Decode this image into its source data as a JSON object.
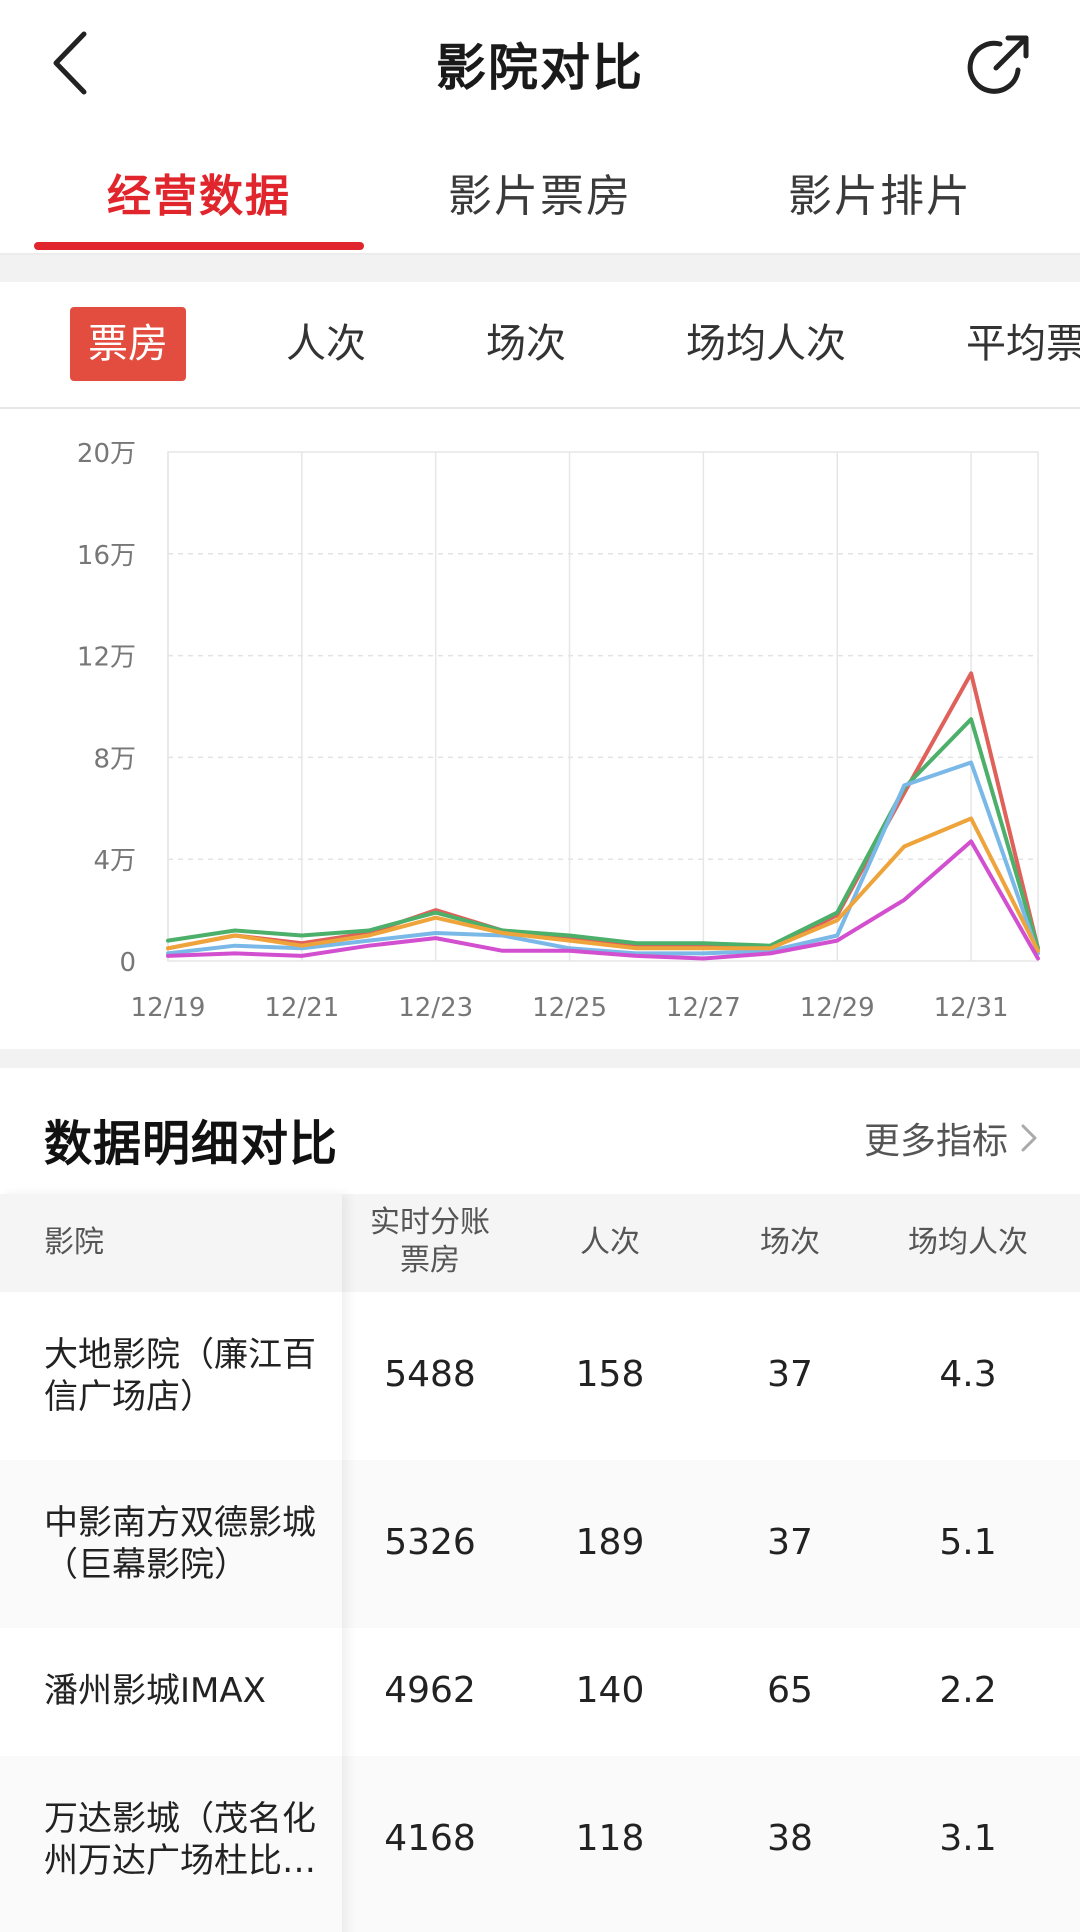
{
  "header": {
    "title": "影院对比",
    "back_icon": "chevron-left-icon",
    "share_icon": "share-icon"
  },
  "main_tabs": [
    {
      "label": "经营数据",
      "active": true
    },
    {
      "label": "影片票房",
      "active": false
    },
    {
      "label": "影片排片",
      "active": false
    }
  ],
  "metric_tabs": [
    {
      "label": "票房",
      "active": true
    },
    {
      "label": "人次",
      "active": false
    },
    {
      "label": "场次",
      "active": false
    },
    {
      "label": "场均人次",
      "active": false
    },
    {
      "label": "平均票",
      "active": false
    }
  ],
  "colors": {
    "accent": "#e0252d",
    "metric_active_bg": "#e34d3f",
    "series": [
      "#e0605a",
      "#4caf6a",
      "#7ab8e8",
      "#eea43a",
      "#d24fcf"
    ]
  },
  "chart_data": {
    "type": "line",
    "x": [
      "12/19",
      "12/20",
      "12/21",
      "12/22",
      "12/23",
      "12/24",
      "12/25",
      "12/26",
      "12/27",
      "12/28",
      "12/29",
      "12/30",
      "12/31",
      "1/1"
    ],
    "x_tick_labels": [
      "12/19",
      "12/21",
      "12/23",
      "12/25",
      "12/27",
      "12/29",
      "12/31"
    ],
    "y_tick_labels": [
      "0",
      "4万",
      "8万",
      "12万",
      "16万",
      "20万"
    ],
    "ylim": [
      0,
      200000
    ],
    "grid": true,
    "series": [
      {
        "color": "#e0605a",
        "values": [
          5000,
          10000,
          7000,
          11000,
          20000,
          12000,
          9000,
          6000,
          6000,
          5000,
          18000,
          66000,
          113000,
          5000
        ]
      },
      {
        "color": "#4caf6a",
        "values": [
          8000,
          12000,
          10000,
          12000,
          19000,
          12000,
          10000,
          7000,
          7000,
          6000,
          19000,
          68000,
          95000,
          5000
        ]
      },
      {
        "color": "#7ab8e8",
        "values": [
          3000,
          6000,
          5000,
          8000,
          11000,
          10000,
          5000,
          3000,
          3000,
          4000,
          10000,
          69000,
          78000,
          3000
        ]
      },
      {
        "color": "#eea43a",
        "values": [
          5000,
          10000,
          6000,
          10000,
          17000,
          11000,
          8000,
          5000,
          5000,
          5000,
          16000,
          45000,
          56000,
          4000
        ]
      },
      {
        "color": "#d24fcf",
        "values": [
          2000,
          3000,
          2000,
          6000,
          9000,
          4000,
          4000,
          2000,
          1000,
          3000,
          8000,
          24000,
          47000,
          1000
        ]
      }
    ]
  },
  "detail": {
    "title": "数据明细对比",
    "more_label": "更多指标",
    "more_icon": "chevron-right-icon",
    "columns": [
      "影院",
      "实时分账\n票房",
      "人次",
      "场次",
      "场均人次"
    ],
    "rows": [
      {
        "name": "大地影院（廉江百信广场店）",
        "box_office": "5488",
        "admissions": "158",
        "shows": "37",
        "avg": "4.3"
      },
      {
        "name": "中影南方双德影城（巨幕影院）",
        "box_office": "5326",
        "admissions": "189",
        "shows": "37",
        "avg": "5.1"
      },
      {
        "name": "潘州影城IMAX",
        "box_office": "4962",
        "admissions": "140",
        "shows": "65",
        "avg": "2.2"
      },
      {
        "name": "万达影城（茂名化州万达广场杜比…",
        "box_office": "4168",
        "admissions": "118",
        "shows": "38",
        "avg": "3.1"
      }
    ]
  }
}
